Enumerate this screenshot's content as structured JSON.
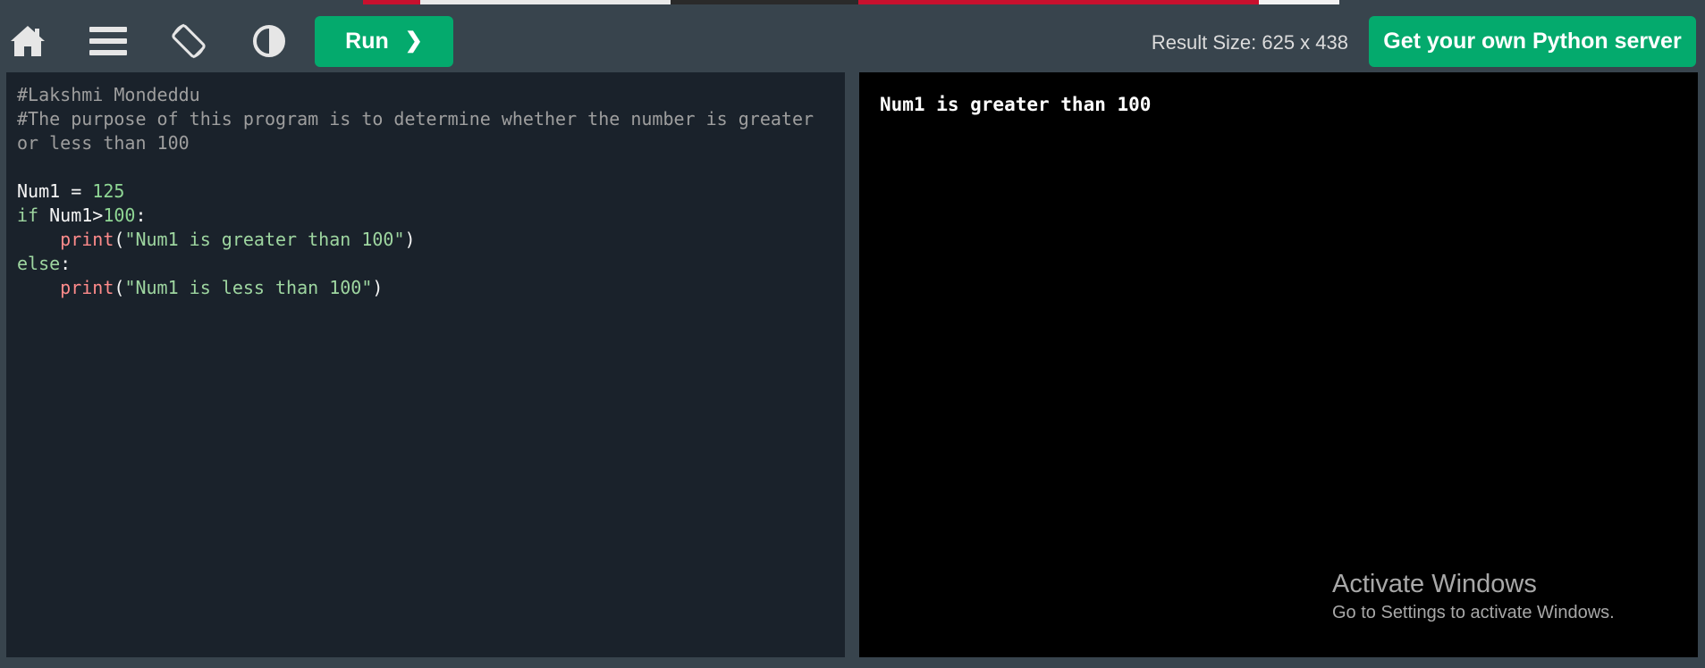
{
  "toolbar": {
    "icons": [
      "home-icon",
      "menu-icon",
      "rotate-icon",
      "contrast-icon"
    ],
    "run_label": "Run",
    "run_chevron": "❯",
    "result_size": "Result Size: 625 x 438",
    "server_label": "Get your own Python server"
  },
  "editor": {
    "line1": "#Lakshmi Mondeddu",
    "line2": "#The purpose of this program is to determine whether the number is greater",
    "line3": "or less than 100",
    "line5_var": "Num1",
    "line5_eq": " = ",
    "line5_num": "125",
    "line6_kw": "if",
    "line6_var": " Num1>",
    "line6_num": "100",
    "line6_colon": ":",
    "line7_indent": "    ",
    "line7_fn": "print",
    "line7_open": "(",
    "line7_str": "\"Num1 is greater than 100\"",
    "line7_close": ")",
    "line8_kw": "else",
    "line8_colon": ":",
    "line9_indent": "    ",
    "line9_fn": "print",
    "line9_open": "(",
    "line9_str": "\"Num1 is less than 100\"",
    "line9_close": ")"
  },
  "result": {
    "output": "Num1 is greater than 100"
  },
  "watermark": {
    "title": "Activate Windows",
    "subtitle": "Go to Settings to activate Windows."
  },
  "colors": {
    "toolbar_bg": "#38444d",
    "accent_green": "#04aa6d",
    "editor_bg": "#1a222b",
    "result_bg": "#000000"
  }
}
